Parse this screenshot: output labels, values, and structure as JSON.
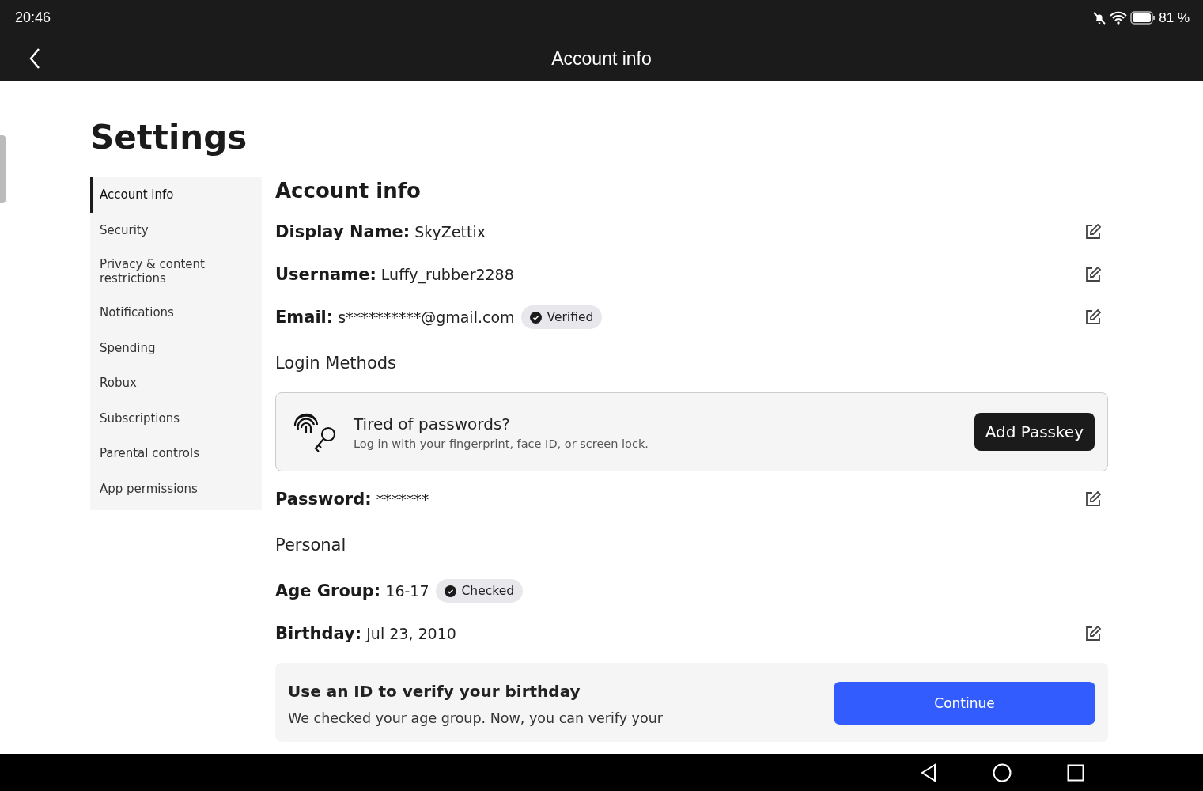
{
  "status_bar": {
    "time": "20:46",
    "battery_text": "81 %"
  },
  "app_bar": {
    "title": "Account info"
  },
  "page_title": "Settings",
  "sidebar": {
    "items": [
      {
        "label": "Account info",
        "selected": true
      },
      {
        "label": "Security",
        "selected": false
      },
      {
        "label": "Privacy & content restrictions",
        "selected": false
      },
      {
        "label": "Notifications",
        "selected": false
      },
      {
        "label": "Spending",
        "selected": false
      },
      {
        "label": "Robux",
        "selected": false
      },
      {
        "label": "Subscriptions",
        "selected": false
      },
      {
        "label": "Parental controls",
        "selected": false
      },
      {
        "label": "App permissions",
        "selected": false
      }
    ]
  },
  "main": {
    "title": "Account info",
    "sections": [
      {
        "kind": "field",
        "label": "Display Name:",
        "value": "SkyZettix",
        "editable": true
      },
      {
        "kind": "field",
        "label": "Username:",
        "value": "Luffy_rubber2288",
        "editable": true
      },
      {
        "kind": "field",
        "label": "Email:",
        "value": "s**********@gmail.com",
        "badge": "Verified",
        "editable": true
      },
      {
        "kind": "heading",
        "text": "Login Methods"
      },
      {
        "kind": "passkey",
        "title": "Tired of passwords?",
        "text": "Log in with your fingerprint, face ID, or screen lock.",
        "button": "Add Passkey"
      },
      {
        "kind": "field",
        "label": "Password:",
        "value": "*******",
        "editable": true
      },
      {
        "kind": "heading",
        "text": "Personal"
      },
      {
        "kind": "field",
        "label": "Age Group:",
        "value": "16-17",
        "badge": "Checked",
        "editable": false
      },
      {
        "kind": "field",
        "label": "Birthday:",
        "value": "Jul 23, 2010",
        "editable": true
      },
      {
        "kind": "verify",
        "title": "Use an ID to verify your birthday",
        "text": "We checked your age group. Now, you can verify your",
        "button": "Continue"
      }
    ]
  }
}
